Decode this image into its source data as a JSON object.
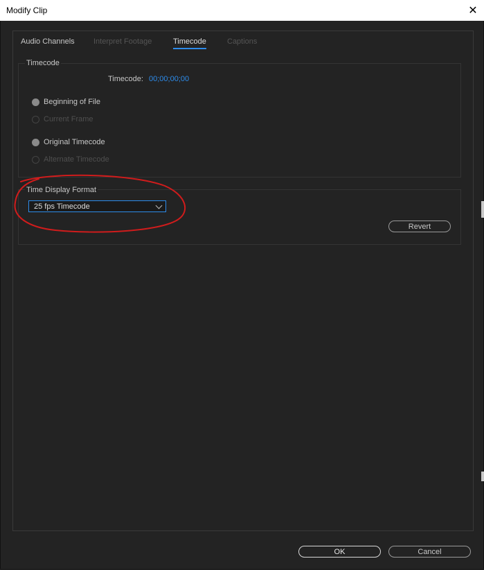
{
  "window": {
    "title": "Modify Clip"
  },
  "tabs": [
    {
      "label": "Audio Channels",
      "state": "normal"
    },
    {
      "label": "Interpret Footage",
      "state": "disabled"
    },
    {
      "label": "Timecode",
      "state": "active"
    },
    {
      "label": "Captions",
      "state": "disabled"
    }
  ],
  "timecode_group": {
    "title": "Timecode",
    "field_label": "Timecode:",
    "field_value": "00;00;00;00",
    "radios": [
      {
        "label": "Beginning of File",
        "checked": true,
        "enabled": true
      },
      {
        "label": "Current Frame",
        "checked": false,
        "enabled": false
      },
      {
        "label": "Original Timecode",
        "checked": true,
        "enabled": true
      },
      {
        "label": "Alternate Timecode",
        "checked": false,
        "enabled": false
      }
    ]
  },
  "format_group": {
    "title": "Time Display Format",
    "selected": "25 fps Timecode",
    "revert_label": "Revert"
  },
  "footer": {
    "ok_label": "OK",
    "cancel_label": "Cancel"
  },
  "colors": {
    "accent": "#2d8ceb",
    "annotation": "#d01c1c",
    "background": "#232323"
  }
}
